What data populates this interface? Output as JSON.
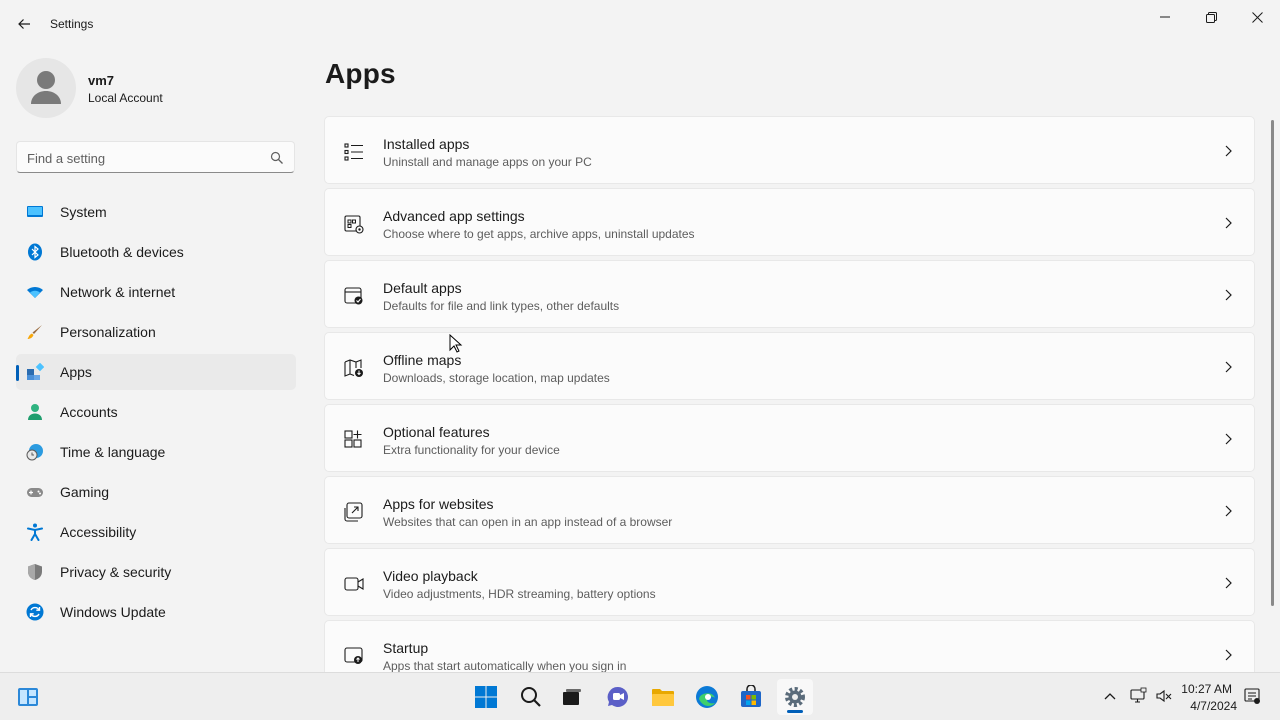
{
  "window": {
    "title": "Settings"
  },
  "profile": {
    "name": "vm7",
    "account_type": "Local Account"
  },
  "search": {
    "placeholder": "Find a setting",
    "value": ""
  },
  "nav": {
    "items": [
      {
        "label": "System",
        "icon": "system-icon",
        "selected": false
      },
      {
        "label": "Bluetooth & devices",
        "icon": "bluetooth-icon",
        "selected": false
      },
      {
        "label": "Network & internet",
        "icon": "wifi-icon",
        "selected": false
      },
      {
        "label": "Personalization",
        "icon": "brush-icon",
        "selected": false
      },
      {
        "label": "Apps",
        "icon": "apps-icon",
        "selected": true
      },
      {
        "label": "Accounts",
        "icon": "accounts-icon",
        "selected": false
      },
      {
        "label": "Time & language",
        "icon": "time-language-icon",
        "selected": false
      },
      {
        "label": "Gaming",
        "icon": "gamepad-icon",
        "selected": false
      },
      {
        "label": "Accessibility",
        "icon": "accessibility-icon",
        "selected": false
      },
      {
        "label": "Privacy & security",
        "icon": "shield-icon",
        "selected": false
      },
      {
        "label": "Windows Update",
        "icon": "update-icon",
        "selected": false
      }
    ]
  },
  "main": {
    "title": "Apps",
    "items": [
      {
        "title": "Installed apps",
        "description": "Uninstall and manage apps on your PC",
        "icon": "list-icon"
      },
      {
        "title": "Advanced app settings",
        "description": "Choose where to get apps, archive apps, uninstall updates",
        "icon": "app-settings-icon"
      },
      {
        "title": "Default apps",
        "description": "Defaults for file and link types, other defaults",
        "icon": "default-apps-icon"
      },
      {
        "title": "Offline maps",
        "description": "Downloads, storage location, map updates",
        "icon": "map-download-icon"
      },
      {
        "title": "Optional features",
        "description": "Extra functionality for your device",
        "icon": "add-grid-icon"
      },
      {
        "title": "Apps for websites",
        "description": "Websites that can open in an app instead of a browser",
        "icon": "open-in-app-icon"
      },
      {
        "title": "Video playback",
        "description": "Video adjustments, HDR streaming, battery options",
        "icon": "video-icon"
      },
      {
        "title": "Startup",
        "description": "Apps that start automatically when you sign in",
        "icon": "startup-icon"
      }
    ]
  },
  "taskbar": {
    "apps": [
      "widgets-icon",
      "start-icon",
      "search-icon",
      "task-view-icon",
      "chat-icon",
      "file-explorer-icon",
      "edge-icon",
      "store-icon",
      "settings-icon"
    ],
    "active_app": "settings-icon",
    "time": "10:27 AM",
    "date": "4/7/2024"
  },
  "colors": {
    "accent": "#005fb8",
    "background": "#f3f3f3",
    "card": "#fbfbfb"
  }
}
